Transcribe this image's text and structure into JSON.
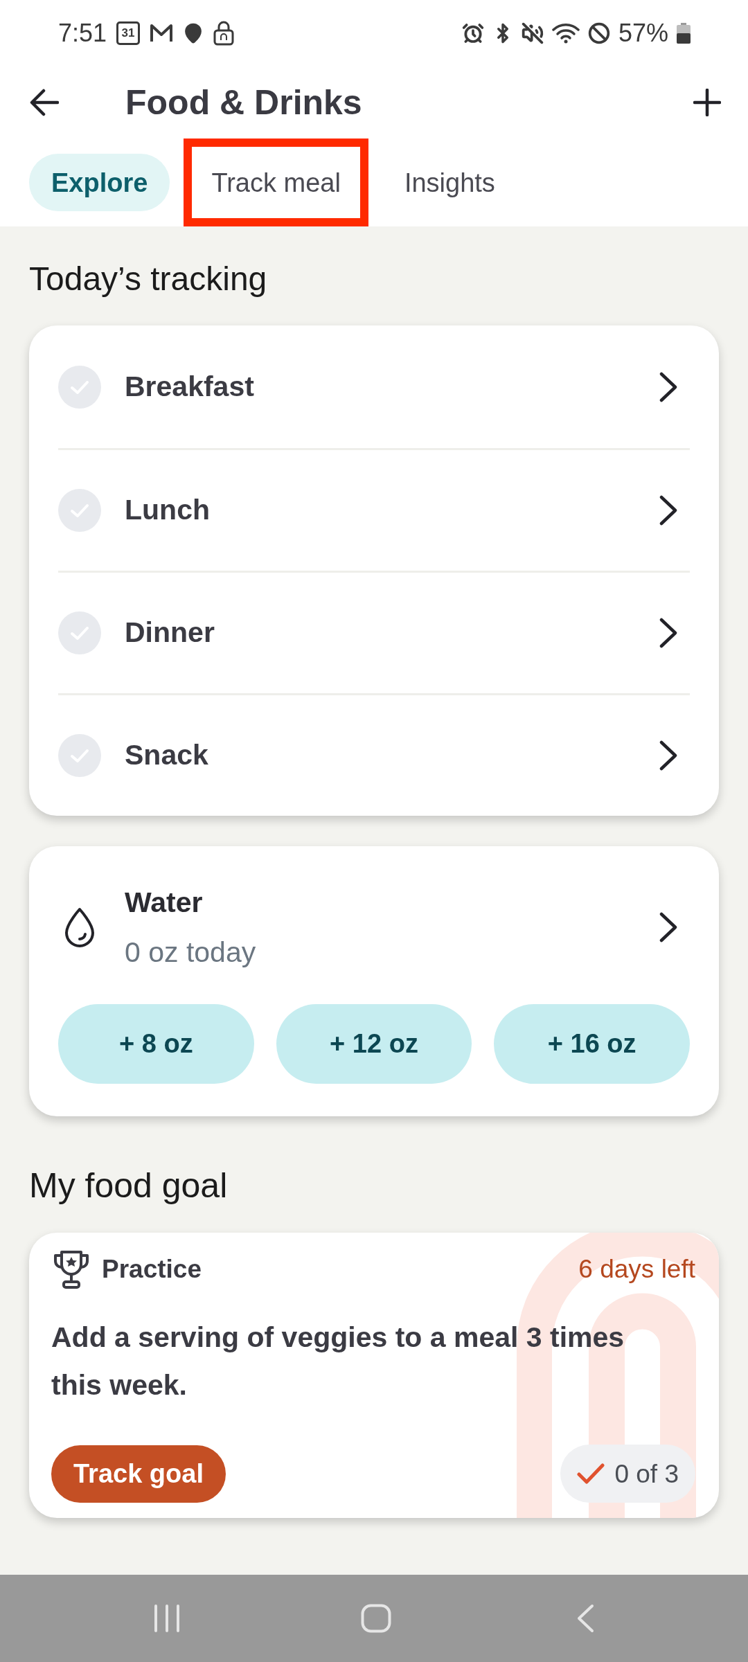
{
  "status_bar": {
    "time": "7:51",
    "calendar_day": "31",
    "battery": "57%"
  },
  "header": {
    "title": "Food & Drinks"
  },
  "tabs": [
    {
      "label": "Explore",
      "selected": true,
      "highlighted": false
    },
    {
      "label": "Track meal",
      "selected": false,
      "highlighted": true
    },
    {
      "label": "Insights",
      "selected": false,
      "highlighted": false
    }
  ],
  "tracking": {
    "title": "Today’s tracking",
    "meals": [
      {
        "name": "Breakfast",
        "checked": false
      },
      {
        "name": "Lunch",
        "checked": false
      },
      {
        "name": "Dinner",
        "checked": false
      },
      {
        "name": "Snack",
        "checked": false
      }
    ]
  },
  "water": {
    "title": "Water",
    "amount": "0 oz today",
    "buttons": [
      "+ 8 oz",
      "+ 12 oz",
      "+ 16 oz"
    ]
  },
  "goal": {
    "title": "My food goal",
    "type": "Practice",
    "days_left": "6 days left",
    "description": "Add a serving of veggies to a meal 3 times this week.",
    "button": "Track goal",
    "progress": "0 of 3"
  }
}
